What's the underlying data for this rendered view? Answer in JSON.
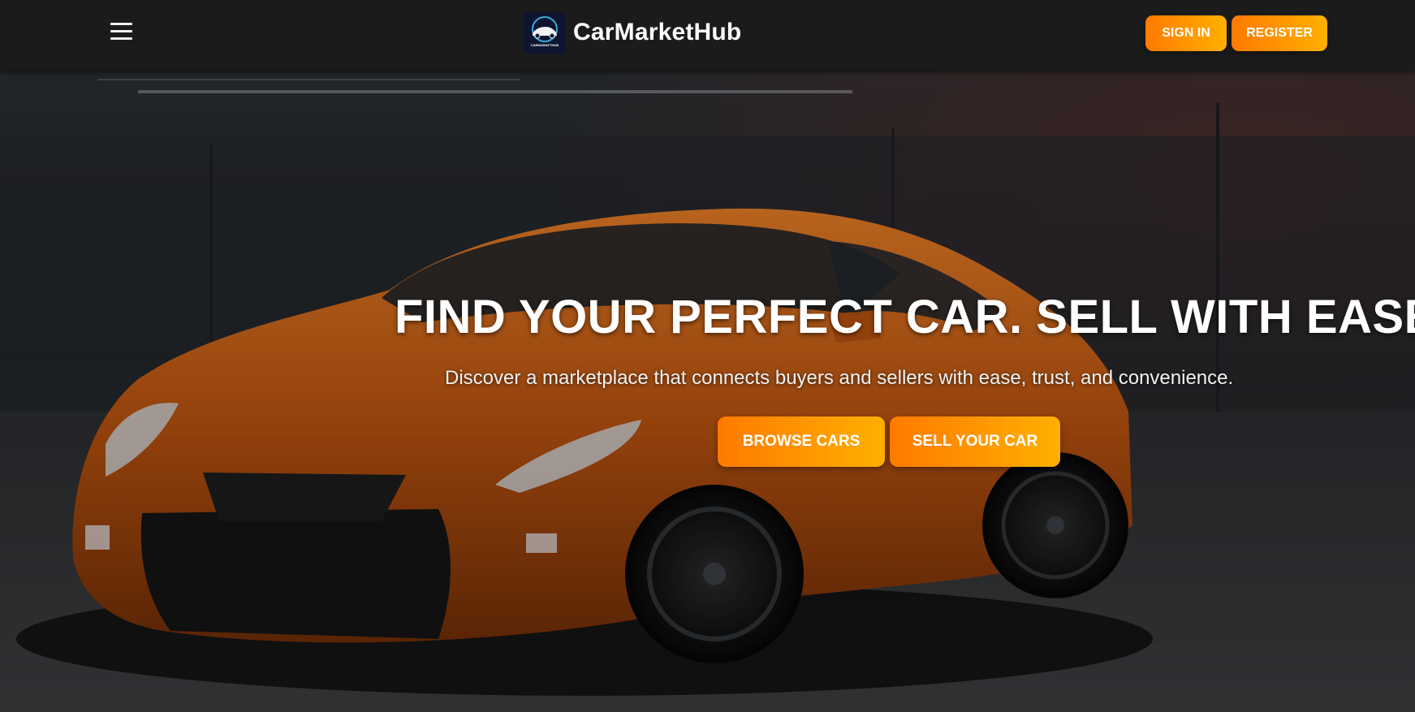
{
  "nav": {
    "menu_icon": "hamburger-menu-icon",
    "brand_name": "CarMarketHub",
    "logo_text": "CARMARKETHUB",
    "sign_in_label": "SIGN IN",
    "register_label": "REGISTER"
  },
  "hero": {
    "title": "FIND YOUR PERFECT CAR. SELL WITH EASE.",
    "subtitle": "Discover a marketplace that connects buyers and sellers with ease, trust, and convenience.",
    "browse_label": "BROWSE CARS",
    "sell_label": "SELL YOUR CAR",
    "background_image": "orange sports car in dark garage"
  },
  "colors": {
    "accent_start": "#ff7a00",
    "accent_end": "#ffb000",
    "navbar_bg": "#1b1b1b",
    "car_body": "#c25a12"
  }
}
